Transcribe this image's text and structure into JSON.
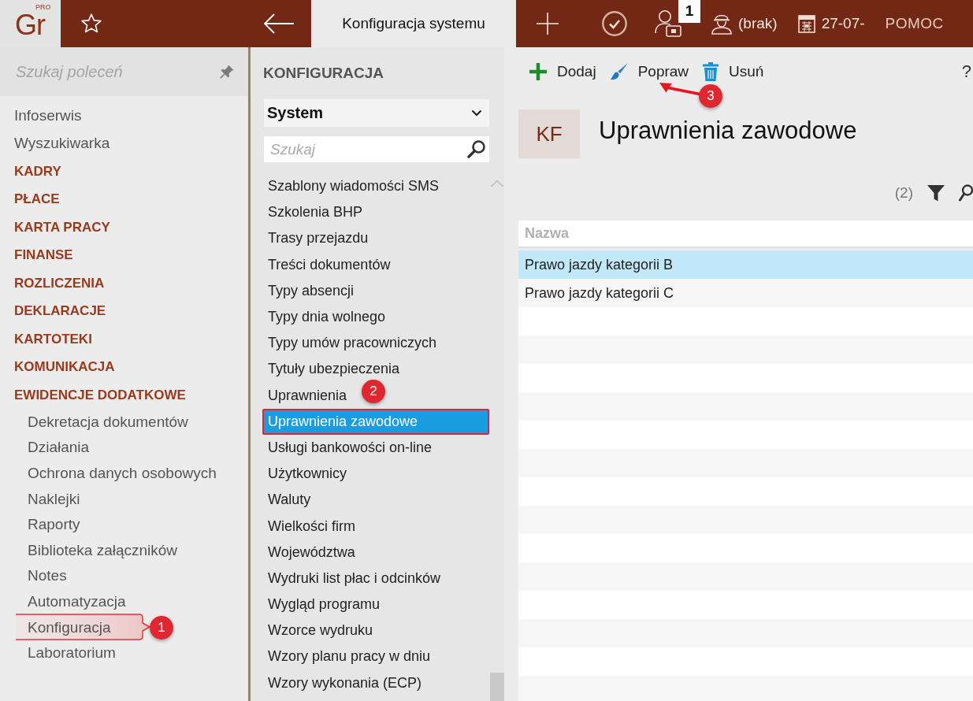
{
  "top_bar": {
    "logo": {
      "text": "Gr",
      "superscript": "PRO"
    },
    "tabs": [
      {
        "label": "Konfiguracja systemu",
        "selected": true
      }
    ],
    "notification_count": "1",
    "user": "(brak)",
    "date": "27-07-",
    "help": "POMOC"
  },
  "sidebar": {
    "search": {
      "placeholder": "Szukaj poleceń"
    },
    "items": [
      {
        "label": "Infoserwis",
        "kind": "link"
      },
      {
        "label": "Wyszukiwarka",
        "kind": "link"
      },
      {
        "label": "KADRY",
        "kind": "group"
      },
      {
        "label": "PŁACE",
        "kind": "group"
      },
      {
        "label": "KARTA PRACY",
        "kind": "group"
      },
      {
        "label": "FINANSE",
        "kind": "group"
      },
      {
        "label": "ROZLICZENIA",
        "kind": "group"
      },
      {
        "label": "DEKLARACJE",
        "kind": "group"
      },
      {
        "label": "KARTOTEKI",
        "kind": "group"
      },
      {
        "label": "KOMUNIKACJA",
        "kind": "group"
      },
      {
        "label": "EWIDENCJE DODATKOWE",
        "kind": "group",
        "children": [
          {
            "label": "Dekretacja dokumentów",
            "kind": "link"
          },
          {
            "label": "Działania",
            "kind": "link"
          },
          {
            "label": "Ochrona danych osobowych",
            "kind": "link"
          },
          {
            "label": "Naklejki",
            "kind": "link"
          },
          {
            "label": "Raporty",
            "kind": "link"
          },
          {
            "label": "Biblioteka załączników",
            "kind": "link"
          },
          {
            "label": "Notes",
            "kind": "link"
          },
          {
            "label": "Automatyzacja",
            "kind": "link"
          },
          {
            "label": "Konfiguracja",
            "kind": "link",
            "callout": "1"
          },
          {
            "label": "Laboratorium",
            "kind": "link"
          }
        ]
      }
    ]
  },
  "config_panel": {
    "title": "KONFIGURACJA",
    "category": {
      "value": "System"
    },
    "search": {
      "placeholder": "Szukaj"
    },
    "items": [
      {
        "label": "Szablony wiadomości SMS",
        "selected": false
      },
      {
        "label": "Szkolenia BHP",
        "selected": false
      },
      {
        "label": "Trasy przejazdu",
        "selected": false
      },
      {
        "label": "Treści dokumentów",
        "selected": false
      },
      {
        "label": "Typy absencji",
        "selected": false
      },
      {
        "label": "Typy dnia wolnego",
        "selected": false
      },
      {
        "label": "Typy umów pracowniczych",
        "selected": false
      },
      {
        "label": "Tytuły ubezpieczenia",
        "selected": false
      },
      {
        "label": "Uprawnienia",
        "selected": false
      },
      {
        "label": "Uprawnienia zawodowe",
        "selected": true,
        "callout": "2"
      },
      {
        "label": "Usługi bankowości on-line",
        "selected": false
      },
      {
        "label": "Użytkownicy",
        "selected": false
      },
      {
        "label": "Waluty",
        "selected": false
      },
      {
        "label": "Wielkości firm",
        "selected": false
      },
      {
        "label": "Województwa",
        "selected": false
      },
      {
        "label": "Wydruki list płac i odcinków",
        "selected": false
      },
      {
        "label": "Wygląd programu",
        "selected": false
      },
      {
        "label": "Wzorce wydruku",
        "selected": false
      },
      {
        "label": "Wzory planu pracy w dniu",
        "selected": false
      },
      {
        "label": "Wzory wykonania (ECP)",
        "selected": false
      }
    ]
  },
  "content": {
    "toolbar": {
      "buttons": [
        {
          "label": "Dodaj",
          "kind": "add"
        },
        {
          "label": "Popraw",
          "kind": "edit",
          "callout": "3"
        },
        {
          "label": "Usuń",
          "kind": "delete"
        }
      ],
      "help": "?"
    },
    "module_badge": "KF",
    "title": "Uprawnienia zawodowe",
    "record_count": "(2)",
    "table": {
      "columns": [
        "Nazwa"
      ],
      "rows": [
        {
          "cells": [
            "Prawo jazdy kategorii B"
          ],
          "selected": true
        },
        {
          "cells": [
            "Prawo jazdy kategorii C"
          ],
          "selected": false
        }
      ]
    }
  }
}
